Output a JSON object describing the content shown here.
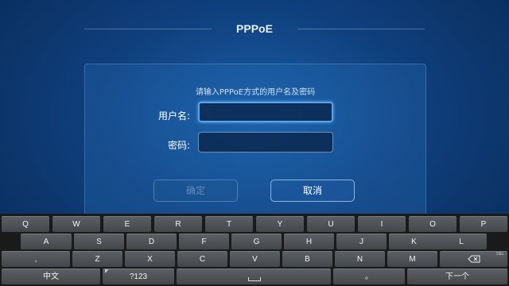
{
  "header": {
    "title": "PPPoE"
  },
  "dialog": {
    "prompt": "请输入PPPoE方式的用户名及密码",
    "username_label": "用户名:",
    "password_label": "密码:",
    "username_value": "",
    "password_value": "",
    "ok_label": "确定",
    "cancel_label": "取消"
  },
  "keyboard": {
    "row1": [
      "Q",
      "W",
      "E",
      "R",
      "T",
      "Y",
      "U",
      "I",
      "O",
      "P"
    ],
    "row2": [
      "A",
      "S",
      "D",
      "F",
      "G",
      "H",
      "J",
      "K",
      "L"
    ],
    "row3": [
      "Z",
      "X",
      "C",
      "V",
      "B",
      "N",
      "M"
    ],
    "comma_label": ",",
    "del_label": "DEL",
    "lang_label": "中文",
    "symbols_label": "?123",
    "period_label": "。",
    "next_label": "下一个"
  }
}
